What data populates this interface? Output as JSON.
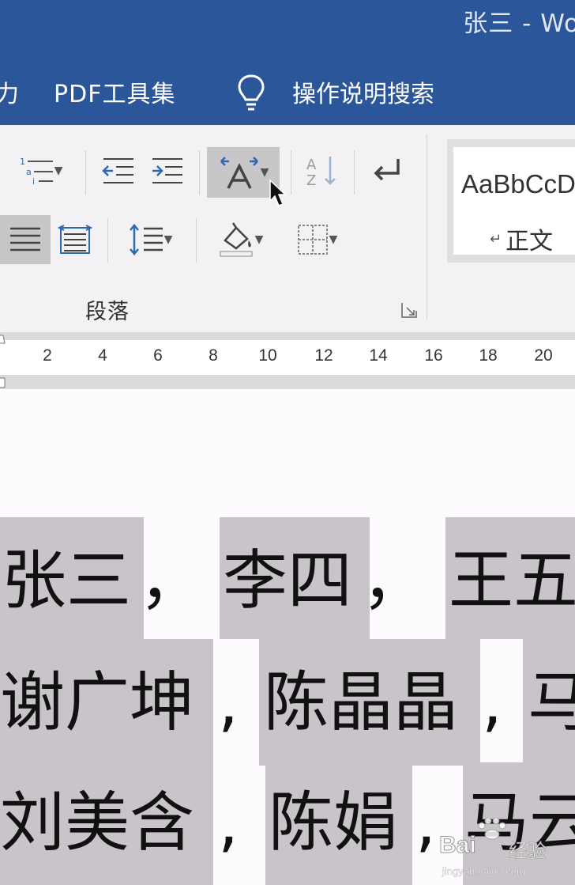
{
  "window": {
    "title": "张三  -  Wo"
  },
  "ribbon_tabs": [
    {
      "label": "力"
    },
    {
      "label": "PDF工具集"
    },
    {
      "label": "操作说明搜索"
    }
  ],
  "ribbon": {
    "group_label": "段落",
    "styles": {
      "sample": "AaBbCcD",
      "name": "正文",
      "name_mark": "↵"
    }
  },
  "ruler": {
    "ticks": [
      "2",
      "4",
      "6",
      "8",
      "10",
      "12",
      "14",
      "16",
      "18",
      "20"
    ]
  },
  "document": {
    "line1": {
      "w1": "张三",
      "c1": "，",
      "w2": "李四",
      "c2": "，",
      "w3": "王五"
    },
    "line2": {
      "w1": "谢广坤",
      "c1": ",",
      "w2": "陈晶晶",
      "c2": ",",
      "w3": "马"
    },
    "line3": {
      "w1": "刘美含",
      "c1": ",",
      "w2": "陈娟",
      "c2": ",",
      "w3": "马云"
    }
  },
  "watermark": {
    "brand": "Bai",
    "brand_cn": "经验",
    "url": "jingyan.baidu.com"
  },
  "colors": {
    "ribbon_blue": "#2b579a",
    "selection": "#c9c4c9",
    "ribbon_bg": "#f3f1f3"
  }
}
